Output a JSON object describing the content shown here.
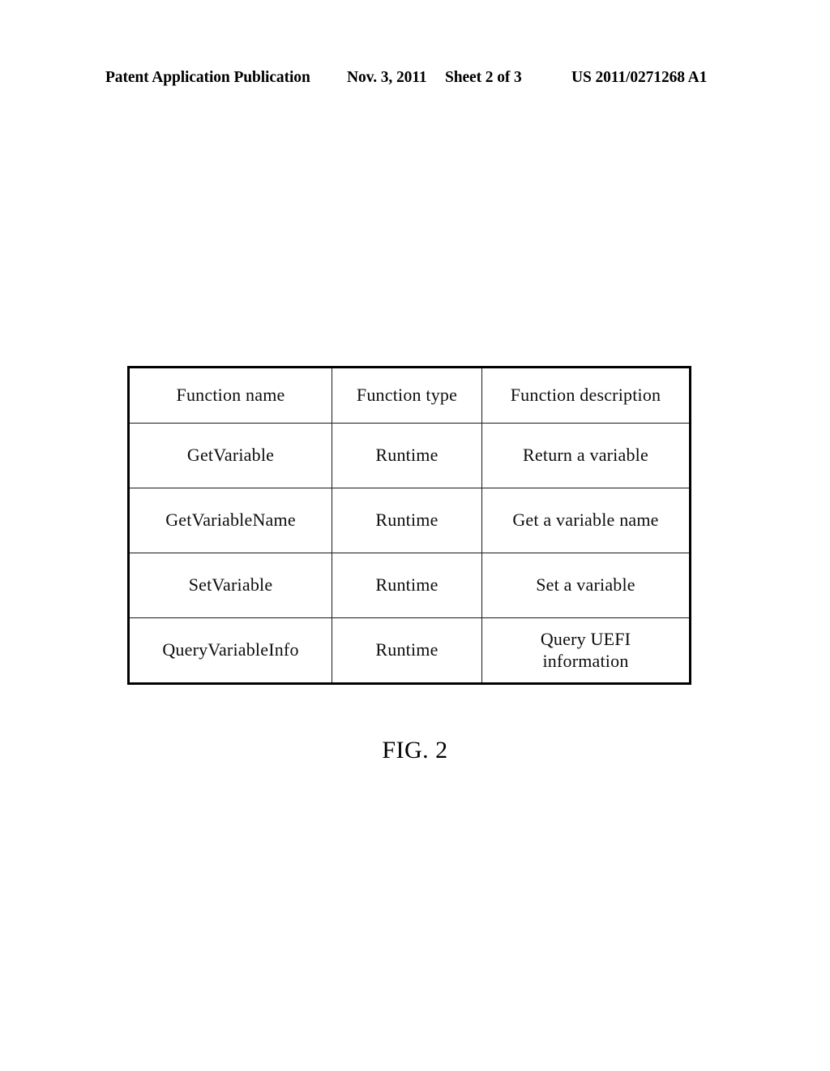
{
  "page": {
    "document_kind": "patent-application-drawing-sheet"
  },
  "header": {
    "publication": "Patent Application Publication",
    "date": "Nov. 3, 2011",
    "sheet": "Sheet 2 of 3",
    "publication_number": "US 2011/0271268 A1"
  },
  "figure": {
    "caption": "FIG. 2",
    "table": {
      "columns": [
        "Function name",
        "Function type",
        "Function description"
      ],
      "rows": [
        {
          "name": "GetVariable",
          "type": "Runtime",
          "description": "Return a variable",
          "description_lines": [
            "Return a variable"
          ]
        },
        {
          "name": "GetVariableName",
          "type": "Runtime",
          "description": "Get a variable name",
          "description_lines": [
            "Get a variable name"
          ]
        },
        {
          "name": "SetVariable",
          "type": "Runtime",
          "description": "Set a variable",
          "description_lines": [
            "Set a variable"
          ]
        },
        {
          "name": "QueryVariableInfo",
          "type": "Runtime",
          "description": "Query UEFI information",
          "description_lines": [
            "Query UEFI",
            "information"
          ]
        }
      ]
    }
  }
}
